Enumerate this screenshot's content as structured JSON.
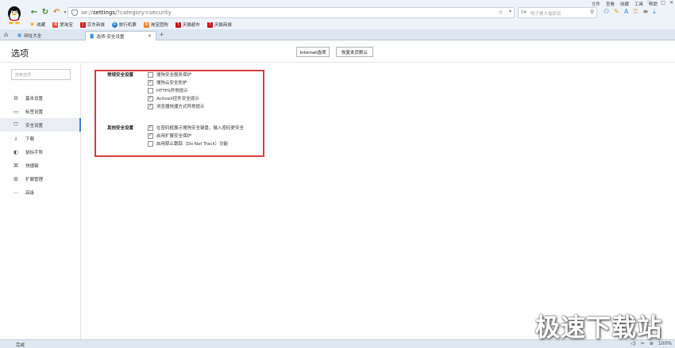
{
  "browser": {
    "url_prefix": "se://",
    "url_host": "settings",
    "url_path": "/?category=security",
    "search_placeholder": "鸭子要大幅助农",
    "menu": [
      "文件",
      "查看",
      "收藏",
      "工具",
      "帮助"
    ],
    "bookmarks": [
      {
        "label": "收藏",
        "color": "#f2b01e",
        "icon": "star-icon"
      },
      {
        "label": "爱淘宝",
        "color": "#e8492f",
        "icon": "ai-taobao-icon"
      },
      {
        "label": "京东商城",
        "color": "#d12020",
        "icon": "jd-icon"
      },
      {
        "label": "旅行机票",
        "color": "#2a84d8",
        "icon": "travel-icon"
      },
      {
        "label": "淘宝团购",
        "color": "#f07a22",
        "icon": "taobao-icon"
      },
      {
        "label": "天猫超市",
        "color": "#c4161c",
        "icon": "tmall-market-icon"
      },
      {
        "label": "天猫商城",
        "color": "#c4161c",
        "icon": "tmall-icon"
      }
    ],
    "tabs": [
      {
        "label": "网址大全",
        "active": false
      },
      {
        "label": "选项-安全设置",
        "active": true
      }
    ],
    "status": "完成",
    "zoom": "100%"
  },
  "page": {
    "title": "选项",
    "internet_options_button": "Internet选项",
    "reset_button": "恢复本页默认",
    "search_placeholder": "搜索选项"
  },
  "sidebar": {
    "items": [
      {
        "label": "基本设置",
        "icon": "gear-icon",
        "active": false
      },
      {
        "label": "标签设置",
        "icon": "tab-icon",
        "active": false
      },
      {
        "label": "安全设置",
        "icon": "shield-icon",
        "active": true
      },
      {
        "label": "下载",
        "icon": "download-icon",
        "active": false
      },
      {
        "label": "鼠标手势",
        "icon": "mouse-icon",
        "active": false
      },
      {
        "label": "快捷键",
        "icon": "keyboard-icon",
        "active": false
      },
      {
        "label": "扩展管理",
        "icon": "extension-icon",
        "active": false
      },
      {
        "label": "高级",
        "icon": "more-icon",
        "active": false
      }
    ]
  },
  "security": {
    "general_title": "常规安全设置",
    "general_options": [
      {
        "label": "搜狗安全服务保护",
        "checked": false
      },
      {
        "label": "搜狗云安全防护",
        "checked": true
      },
      {
        "label": "HTTPS异常提示",
        "checked": false
      },
      {
        "label": "ActiveX控件安全提示",
        "checked": true
      },
      {
        "label": "浏览器快捷方式异常提示",
        "checked": true
      }
    ],
    "other_title": "其他安全设置",
    "other_options": [
      {
        "label": "在密码框展示搜狗安全键盘，输入密码更安全",
        "checked": true
      },
      {
        "label": "启用扩展安全保护",
        "checked": true
      },
      {
        "label": "启用禁止跟踪（Do Not Track）功能",
        "checked": false
      }
    ],
    "highlight_color": "#d43d3d"
  },
  "watermark": "极速下载站"
}
